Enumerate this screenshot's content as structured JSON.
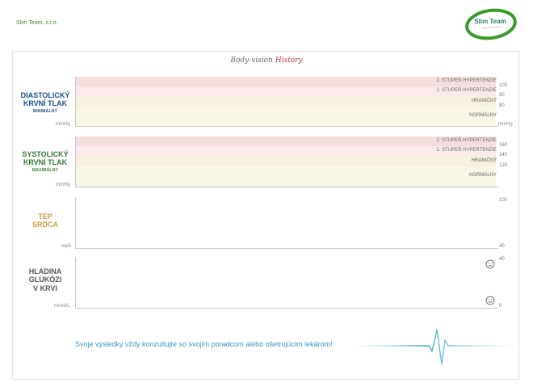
{
  "header": {
    "company": "Slim Team, s.r.o.",
    "logo_text": "Slim Team"
  },
  "title": {
    "part1": "Body-vision ",
    "part2": "History"
  },
  "sections": {
    "diastolic": {
      "line1": "DIASTOLICKÝ",
      "line2": "KRVNÍ TLAK",
      "sub": "MINIMÁLNÝ",
      "unit_left": "mmHg",
      "unit_right": "mmHg",
      "bands": [
        "2. STUPEŇ HYPERTENZIE",
        "1. STUPEŇ HYPERTENZIE",
        "HRANIČNÝ",
        "NORMÁLNY"
      ],
      "ticks": [
        "100",
        "90",
        "80"
      ]
    },
    "systolic": {
      "line1": "SYSTOLICKÝ",
      "line2": "KRVNÍ TLAK",
      "sub": "MAXIMÁLNY",
      "unit_left": "mmHg",
      "bands": [
        "2. STUPEŇ HYPERTENZIE",
        "1. STUPEŇ HYPERTENZIE",
        "HRANIČNÝ",
        "NORMÁLNY"
      ],
      "ticks": [
        "160",
        "140",
        "120"
      ]
    },
    "pulse": {
      "line1": "TEP",
      "line2": "SRDCA",
      "unit_left": "tepů",
      "ticks": [
        "100",
        "40"
      ]
    },
    "glucose": {
      "line1": "HLADINA",
      "line2": "GLUKÓZI",
      "line3": "V KRVI",
      "unit_left": "mmol/L",
      "ticks": [
        "40",
        "0"
      ]
    }
  },
  "footer": {
    "message": "Svoje výsledky vždy konzultujte so svojim poradcom alebo ošetrujúcim lekárom!"
  },
  "colors": {
    "green": "#2e7d32",
    "blue": "#1a4f8a",
    "gold": "#c8a23a",
    "band_stage2": "#f7dede",
    "band_stage1": "#faeaea",
    "band_border": "#f7f0dc",
    "band_normal": "#f9f6e6",
    "accent_blue": "#3d95c4"
  }
}
